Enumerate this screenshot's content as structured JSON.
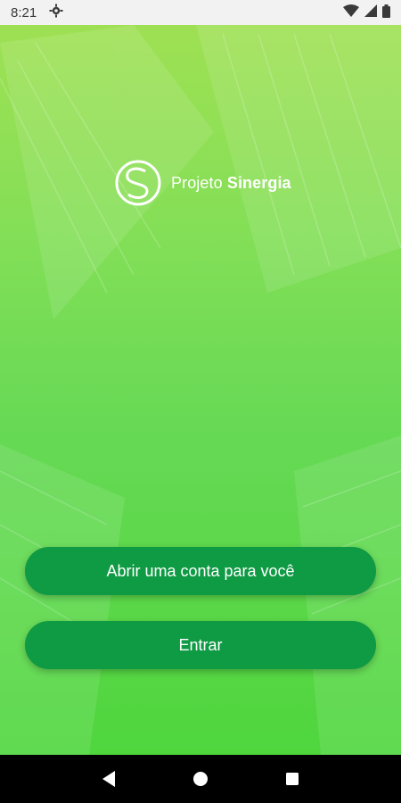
{
  "status_bar": {
    "time": "8:21",
    "icons": [
      "settings-icon",
      "wifi-icon",
      "signal-icon",
      "battery-icon"
    ]
  },
  "brand": {
    "logo_letter": "S",
    "name_light": "Projeto ",
    "name_bold": "Sinergia"
  },
  "actions": {
    "open_account_label": "Abrir uma conta para você",
    "login_label": "Entrar"
  },
  "navigation": {
    "icons": [
      "back-icon",
      "home-icon",
      "recents-icon"
    ]
  },
  "colors": {
    "background_top": "#9fe053",
    "background_bottom": "#4fd63d",
    "button": "#0f9a44"
  }
}
